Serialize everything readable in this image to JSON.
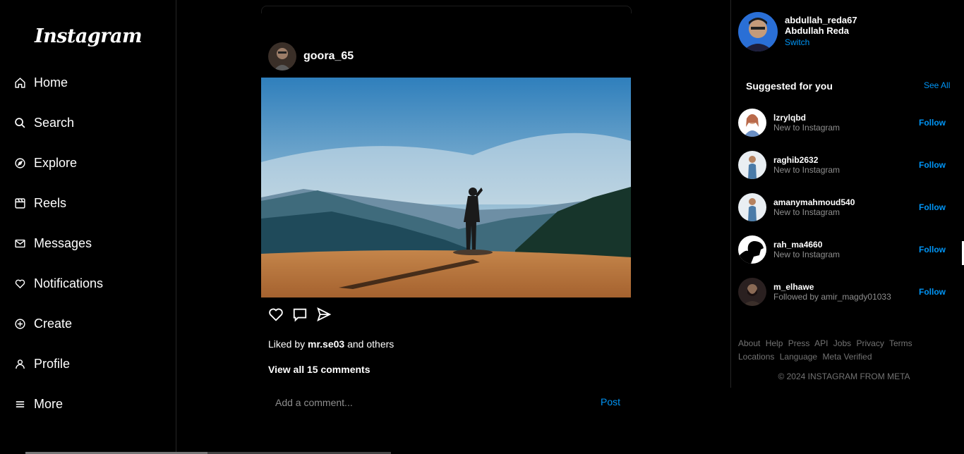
{
  "app": {
    "logo": "Instagram"
  },
  "sidebar": {
    "items": [
      {
        "label": "Home",
        "icon": "home-icon"
      },
      {
        "label": "Search",
        "icon": "search-icon"
      },
      {
        "label": "Explore",
        "icon": "compass-icon"
      },
      {
        "label": "Reels",
        "icon": "reels-icon"
      },
      {
        "label": "Messages",
        "icon": "mail-icon"
      },
      {
        "label": "Notifications",
        "icon": "heart-icon"
      },
      {
        "label": "Create",
        "icon": "plus-circle-icon"
      },
      {
        "label": "Profile",
        "icon": "user-icon"
      },
      {
        "label": "More",
        "icon": "menu-icon"
      }
    ]
  },
  "post": {
    "username": "goora_65",
    "liked_by_prefix": "Liked by",
    "liked_by_user": "mr.se03",
    "liked_by_suffix": "and others",
    "view_comments": "View all 15 comments",
    "comment_placeholder": "Add a comment...",
    "post_label": "Post"
  },
  "profile": {
    "username": "abdullah_reda67",
    "name": "Abdullah Reda",
    "switch_label": "Switch"
  },
  "suggestions": {
    "title": "Suggested for you",
    "see_all": "See All",
    "follow_label": "Follow",
    "items": [
      {
        "username": "lzrylqbd",
        "subtitle": "New to Instagram"
      },
      {
        "username": "raghib2632",
        "subtitle": "New to Instagram"
      },
      {
        "username": "amanymahmoud540",
        "subtitle": "New to Instagram"
      },
      {
        "username": "rah_ma4660",
        "subtitle": "New to Instagram"
      },
      {
        "username": "m_elhawe",
        "subtitle": "Followed by amir_magdy01033"
      }
    ]
  },
  "footer": {
    "links": [
      "About",
      "Help",
      "Press",
      "API",
      "Jobs",
      "Privacy",
      "Terms",
      "Locations",
      "Language",
      "Meta Verified"
    ],
    "copyright": "© 2024 INSTAGRAM FROM META"
  },
  "colors": {
    "accent": "#0095f6",
    "background": "#000000",
    "muted": "#8e8e8e"
  }
}
